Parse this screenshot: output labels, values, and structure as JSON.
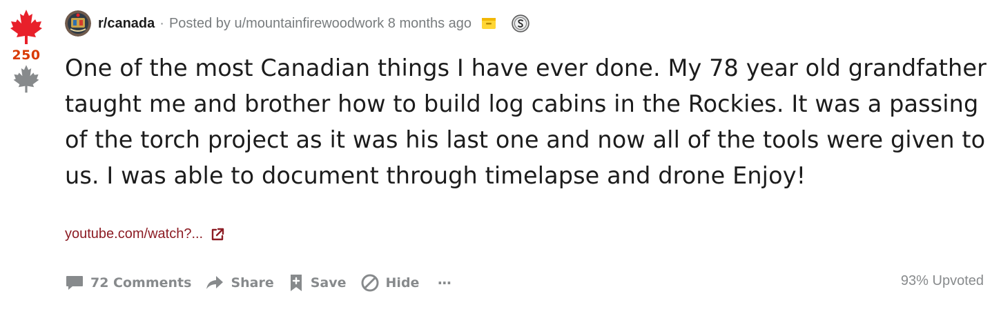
{
  "colors": {
    "upvote_red": "#e8202a",
    "score_red": "#d93a00",
    "downvote_gray": "#878a8c",
    "link_maroon": "#8c1c24",
    "meta_gray": "#787c7e",
    "action_gray": "#878a8c"
  },
  "vote": {
    "up_icon": "maple-leaf-upvote-icon",
    "score": "250",
    "down_icon": "maple-leaf-downvote-icon"
  },
  "header": {
    "subreddit": "r/canada",
    "separator": "·",
    "posted_by_prefix": "Posted by",
    "author": "u/mountainfirewoodwork",
    "age": "8 months ago",
    "awards": [
      "archived-box-icon",
      "silver-award-icon"
    ]
  },
  "title": "One of the most Canadian things I have ever done. My 78 year old grandfather taught me and brother how to build log cabins in the Rockies. It was a passing of the torch project as it was his last one and now all of the tools were given to us. I was able to document through timelapse and drone Enjoy!",
  "link": {
    "text": "youtube.com/watch?...",
    "icon": "external-link-icon"
  },
  "actions": {
    "comments": "72 Comments",
    "share": "Share",
    "save": "Save",
    "hide": "Hide",
    "more": "···"
  },
  "upvote_ratio": "93% Upvoted"
}
